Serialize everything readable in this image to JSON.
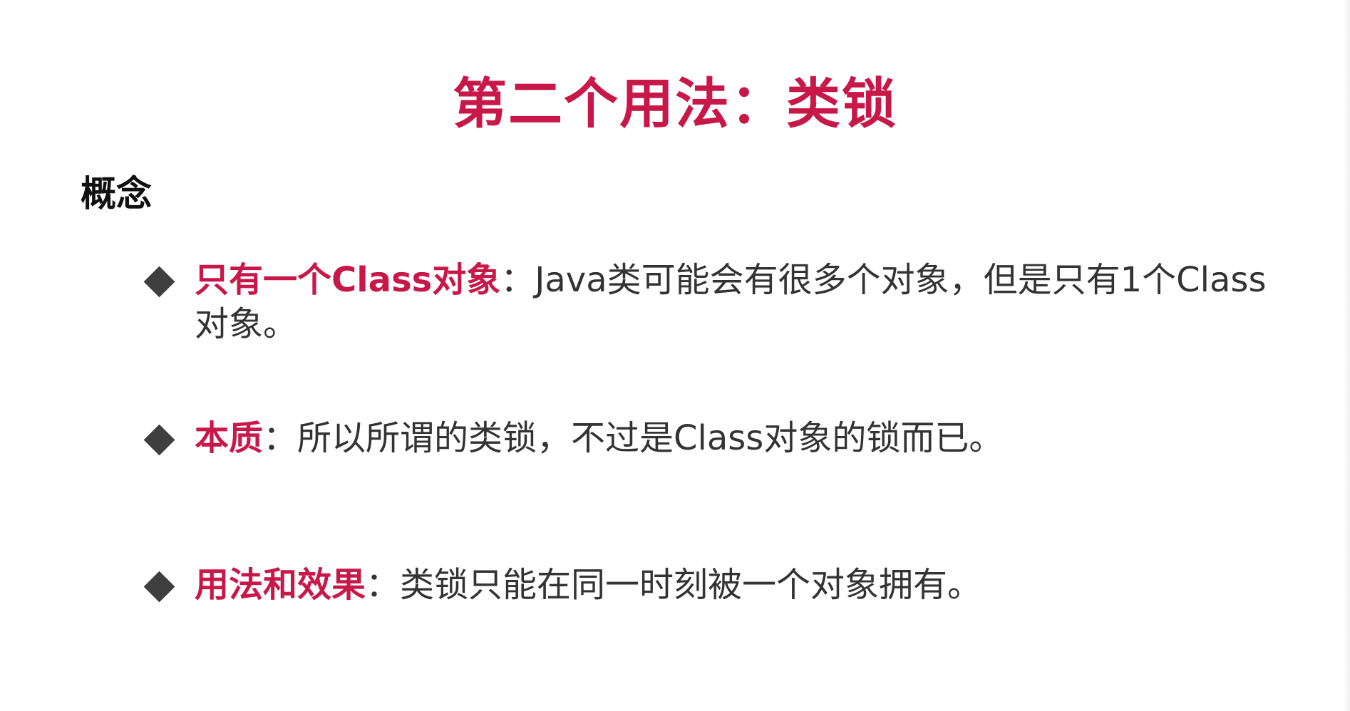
{
  "colors": {
    "accent": "#c8184a",
    "text": "#333333",
    "heading": "#111111",
    "bullet": "#3f3f3f"
  },
  "slide": {
    "title": "第二个用法：类锁",
    "section_heading": "概念",
    "bullets": [
      {
        "key": "只有一个Class对象",
        "separator": "：",
        "text": "Java类可能会有很多个对象，但是只有1个Class对象。"
      },
      {
        "key": "本质",
        "separator": "：",
        "text": "所以所谓的类锁，不过是Class对象的锁而已。"
      },
      {
        "key": "用法和效果",
        "separator": "：",
        "text": "类锁只能在同一时刻被一个对象拥有。"
      }
    ]
  }
}
